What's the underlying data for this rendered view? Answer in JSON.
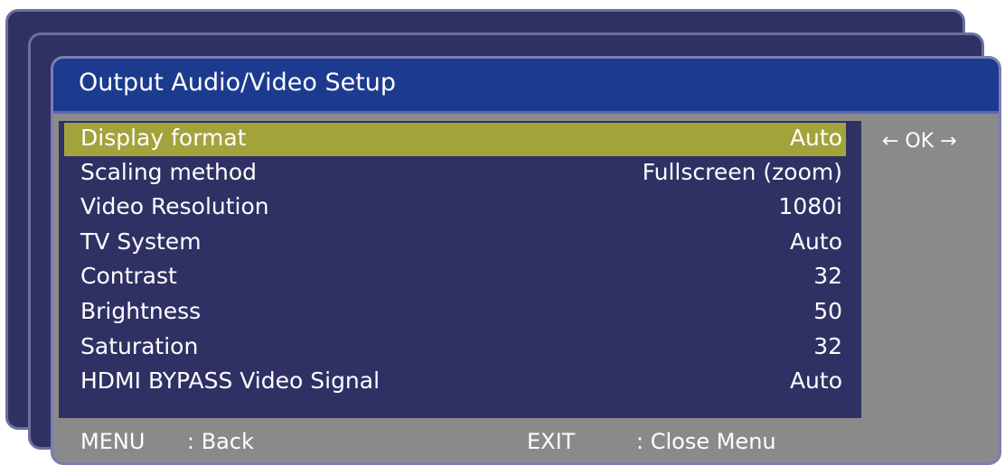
{
  "menu": {
    "title": "Output Audio/Video Setup",
    "hint": "← OK →",
    "items": [
      {
        "label": "Display format",
        "value": "Auto"
      },
      {
        "label": "Scaling method",
        "value": "Fullscreen (zoom)"
      },
      {
        "label": "Video Resolution",
        "value": "1080i"
      },
      {
        "label": "TV System",
        "value": "Auto"
      },
      {
        "label": "Contrast",
        "value": "32"
      },
      {
        "label": "Brightness",
        "value": "50"
      },
      {
        "label": "Saturation",
        "value": "32"
      },
      {
        "label": "HDMI BYPASS Video Signal",
        "value": "Auto"
      }
    ],
    "selected_index": 0
  },
  "footer": {
    "menu_key": "MENU",
    "menu_action": ": Back",
    "exit_key": "EXIT",
    "exit_action": ": Close Menu"
  },
  "colors": {
    "title_bar": "#1c3a8e",
    "list_background": "#2f3164",
    "selected_row": "#a3a33c",
    "side_panel": "#8a8a8a"
  }
}
